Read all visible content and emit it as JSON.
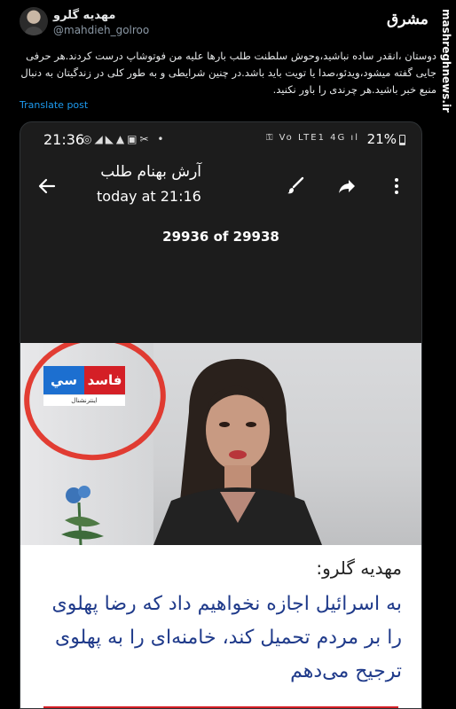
{
  "tweet": {
    "author_name": "مهدیه گلرو",
    "author_handle": "@mahdieh_golroo",
    "text": "دوستان ،انقدر ساده نباشید،وحوش سلطنت طلب بارها علیه من فوتوشاپ درست کردند.هر حرفی جایی گفته میشود،ویدئو،صدا یا تویت باید باشد.در چنین شرایطی و به طور کلی در زندگیتان به دنبال منبع خبر باشید.هر چرندی را باور نکنید.",
    "translate_label": "Translate post"
  },
  "branding": {
    "logo_text": "مشرق",
    "watermark": "mashreghnews.ir"
  },
  "phone": {
    "status": {
      "time": "21:36",
      "left_icons": "◎◢◣▲▣✂ •",
      "right_icons": "⚿ Vo LTE1 4G ıl",
      "battery": "21%"
    },
    "viewer": {
      "contact_name": "آرش بهنام طلب",
      "timestamp": "today at 21:16",
      "counter": "29936 of 29938"
    },
    "video": {
      "logo_red_text": "فاسد",
      "logo_blue_text": "سي",
      "logo_sub_text": "اينترنشنال"
    },
    "caption": {
      "speaker": "مهدیه گلرو:",
      "quote": "به اسرائیل اجازه نخواهیم داد که رضا پهلوی را بر مردم تحمیل کند، خامنه‌ای را به پهلوی ترجیح می‌دهم"
    }
  },
  "colors": {
    "accent_link": "#1d9bf0",
    "highlight_circle": "#e12a1f",
    "quote_text": "#1f3a8a"
  }
}
